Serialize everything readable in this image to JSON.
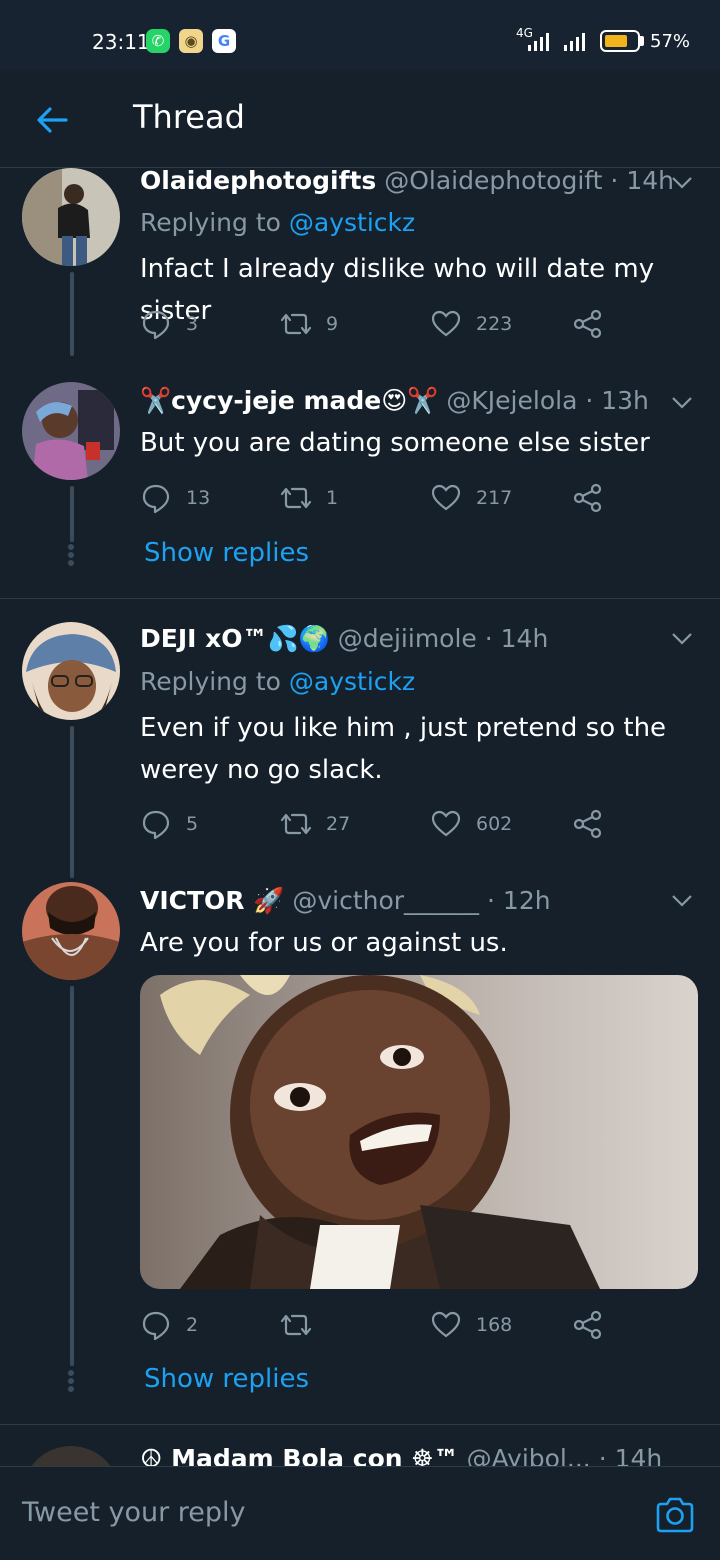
{
  "status_bar": {
    "time": "23:11",
    "network": "4G",
    "battery": "57%",
    "battery_level": 0.57,
    "accent_battery": "#f2b41d"
  },
  "header": {
    "title": "Thread"
  },
  "colors": {
    "background": "#15202b",
    "accent": "#1da1f2",
    "secondary_text": "#8899a6"
  },
  "tweets": [
    {
      "name": "Olaidephotogifts",
      "handle": "@Olaidephotogift",
      "time": "14h",
      "replying_prefix": "Replying to",
      "replying_to": "@aystickz",
      "text": "Infact I already dislike who will date my sister",
      "replies": "3",
      "retweets": "9",
      "likes": "223"
    },
    {
      "name": "✂️cycy-jeje made😍✂️",
      "handle": "@KJejelola",
      "time": "13h",
      "text": "But you are dating someone else sister",
      "replies": "13",
      "retweets": "1",
      "likes": "217",
      "show_replies": "Show replies"
    },
    {
      "name": "DEJI xO™💦🌍",
      "handle": "@dejiimole",
      "time": "14h",
      "replying_prefix": "Replying to",
      "replying_to": "@aystickz",
      "text": "Even if you like him , just pretend so the werey no go slack.",
      "replies": "5",
      "retweets": "27",
      "likes": "602"
    },
    {
      "name": "VICTOR 🚀",
      "handle": "@victhor______",
      "time": "12h",
      "text": "Are you for us or against us.",
      "replies": "2",
      "retweets": "",
      "likes": "168",
      "show_replies": "Show replies"
    },
    {
      "name": "☮ Madam Bola con ☸™",
      "handle": "@Ayibol...",
      "time": "14h"
    }
  ],
  "reply_bar": {
    "placeholder": "Tweet your reply"
  }
}
